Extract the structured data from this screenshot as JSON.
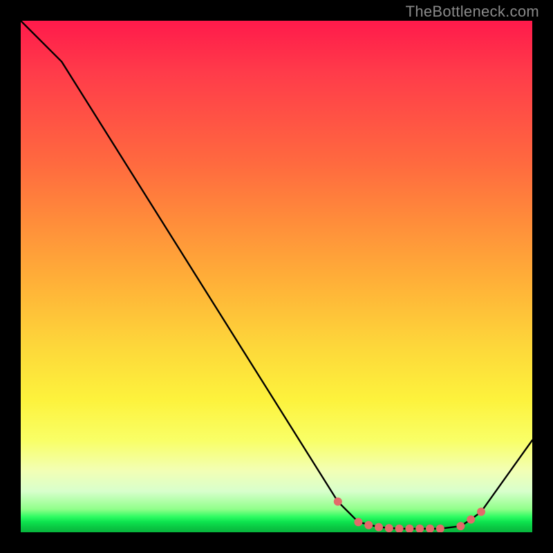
{
  "attribution": "TheBottleneck.com",
  "chart_data": {
    "type": "line",
    "title": "",
    "xlabel": "",
    "ylabel": "",
    "xlim": [
      0,
      100
    ],
    "ylim": [
      0,
      100
    ],
    "series": [
      {
        "name": "bottleneck-curve",
        "x": [
          0,
          8,
          62,
          66,
          70,
          74,
          78,
          82,
          86,
          88,
          90,
          100
        ],
        "values": [
          100,
          92,
          6,
          2,
          1,
          0.7,
          0.7,
          0.7,
          1.2,
          2.5,
          4,
          18
        ]
      }
    ],
    "markers": {
      "x": [
        62,
        66,
        68,
        70,
        72,
        74,
        76,
        78,
        80,
        82,
        86,
        88,
        90
      ],
      "values": [
        6,
        2,
        1.4,
        1,
        0.8,
        0.7,
        0.7,
        0.7,
        0.7,
        0.7,
        1.2,
        2.5,
        4
      ],
      "color": "#e36a6a",
      "radius_px": 6
    },
    "colors": {
      "curve": "#000000",
      "marker": "#e36a6a",
      "attribution": "#8a8a8a"
    }
  }
}
